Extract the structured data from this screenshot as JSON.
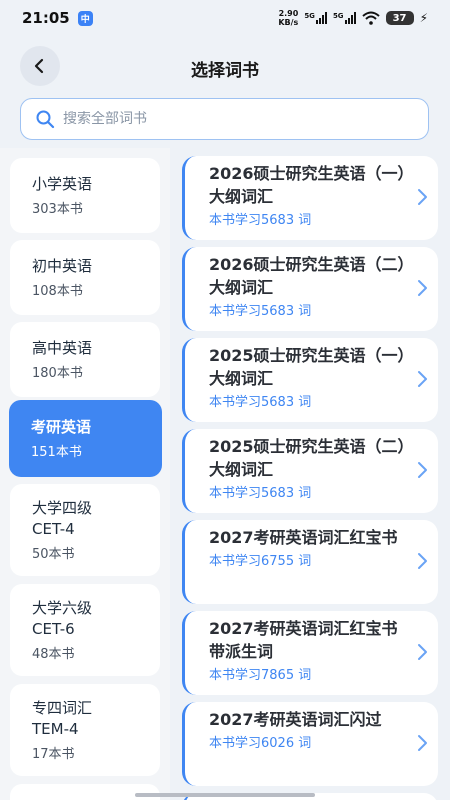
{
  "status_bar": {
    "time": "21:05",
    "app_icon": "中",
    "net_speed_top": "2.90",
    "net_speed_bottom": "KB/s",
    "sim1": "5G",
    "sim2": "5G",
    "battery": "37"
  },
  "header": {
    "title": "选择词书",
    "back_icon": "chevron-left-icon"
  },
  "search": {
    "placeholder": "搜索全部词书",
    "value": ""
  },
  "categories": [
    {
      "name": "小学英语",
      "count": "303本书",
      "active": false
    },
    {
      "name": "初中英语",
      "count": "108本书",
      "active": false
    },
    {
      "name": "高中英语",
      "count": "180本书",
      "active": false
    },
    {
      "name": "考研英语",
      "count": "151本书",
      "active": true
    },
    {
      "name": "大学四级\nCET-4",
      "count": "50本书",
      "active": false
    },
    {
      "name": "大学六级\nCET-6",
      "count": "48本书",
      "active": false
    },
    {
      "name": "专四词汇\nTEM-4",
      "count": "17本书",
      "active": false
    }
  ],
  "books": [
    {
      "title": "2026硕士研究生英语（一）大纲词汇",
      "subtitle": "本书学习5683 词"
    },
    {
      "title": "2026硕士研究生英语（二）大纲词汇",
      "subtitle": "本书学习5683 词"
    },
    {
      "title": "2025硕士研究生英语（一）大纲词汇",
      "subtitle": "本书学习5683 词"
    },
    {
      "title": "2025硕士研究生英语（二）大纲词汇",
      "subtitle": "本书学习5683 词"
    },
    {
      "title": "2027考研英语词汇红宝书",
      "subtitle": "本书学习6755 词"
    },
    {
      "title": "2027考研英语词汇红宝书 带派生词",
      "subtitle": "本书学习7865 词"
    },
    {
      "title": "2027考研英语词汇闪过",
      "subtitle": "本书学习6026 词"
    }
  ],
  "colors": {
    "accent": "#3f86f2",
    "background": "#eef2f7",
    "search_border": "#9ec2f2"
  }
}
